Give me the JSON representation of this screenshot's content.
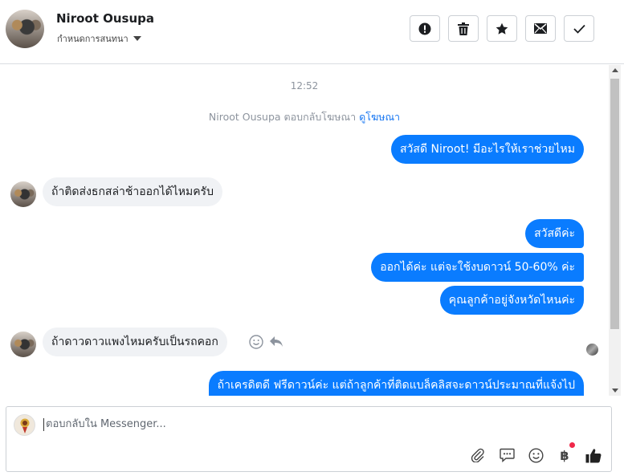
{
  "header": {
    "contact_name": "Niroot Ousupa",
    "assign_label": "กำหนดการสนทนา",
    "buttons": [
      "mark-spam",
      "delete",
      "star",
      "mark-unread",
      "mark-done"
    ]
  },
  "thread": {
    "time": "12:52",
    "system_note": "Niroot Ousupa ตอบกลับโฆษณา",
    "system_link": "ดูโฆษณา",
    "messages": [
      {
        "from": "page",
        "text": "สวัสดี Niroot! มีอะไรให้เราช่วยไหม"
      },
      {
        "from": "user",
        "text": "ถ้าติดส่งธกสล่าช้าออกได้ไหมครับ"
      },
      {
        "from": "page",
        "text": "สวัสดีค่ะ"
      },
      {
        "from": "page",
        "text": "ออกได้ค่ะ  แต่จะใช้งบดาวน์ 50-60% ค่ะ"
      },
      {
        "from": "page",
        "text": "คุณลูกค้าอยู่จังหวัดไหนค่ะ"
      },
      {
        "from": "user",
        "text": "ถ้าดาวดาวแพงไหมครับเป็นรถคอก"
      },
      {
        "from": "page",
        "text": "ถ้าเครดิตดี ฟรีดาวน์ค่ะ แต่ถ้าลูกค้าที่ติดแบล็คลิสจะดาวน์ประมาณที่แจ้งไป"
      }
    ]
  },
  "composer": {
    "placeholder": "ตอบกลับใน Messenger...",
    "icons": [
      "attachment-icon",
      "saved-reply-icon",
      "emoji-icon",
      "payment-icon",
      "thumbs-up-icon"
    ],
    "payment_symbol": "฿"
  },
  "colors": {
    "outgoing_bubble": "#0a7cff",
    "incoming_bubble": "#f0f2f5",
    "link": "#1877f2"
  }
}
